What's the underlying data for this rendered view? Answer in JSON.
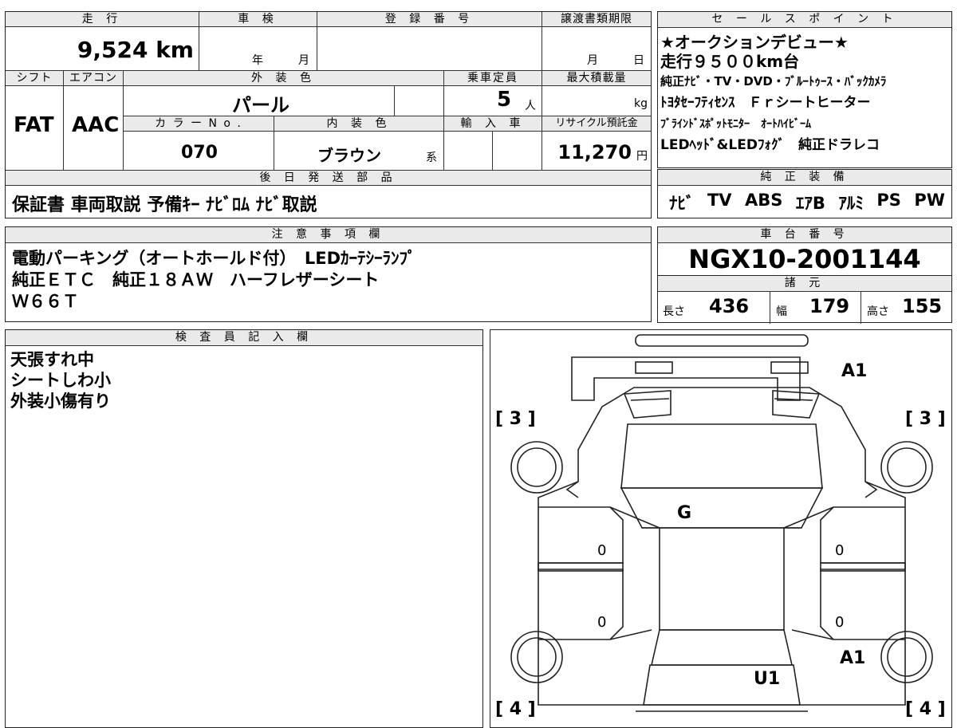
{
  "top_table": {
    "mileage_header": "走 行",
    "mileage_value": "9,524 km",
    "inspection_header": "車 検",
    "inspection_year": "年",
    "inspection_month": "月",
    "registration_header": "登 録 番 号",
    "transfer_header": "譲渡書類期限",
    "transfer_month": "月",
    "transfer_day": "日",
    "shift_header": "シフト",
    "ac_header": "エアコン",
    "ext_color_header": "外 装 色",
    "capacity_header": "乗車定員",
    "load_header": "最大積載量",
    "shift_value": "FAT",
    "ac_value": "AAC",
    "ext_color_value": "パール",
    "capacity_value": "5",
    "capacity_unit": "人",
    "load_unit": "kg",
    "color_no_header": "カ ラ ー N o .",
    "int_color_header": "内 装 色",
    "import_header": "輸 入 車",
    "recycle_header": "リサイクル預託金",
    "color_no_value": "070",
    "int_color_value": "ブラウン",
    "int_color_suffix": "系",
    "recycle_value": "11,270",
    "recycle_unit": "円",
    "later_parts_header": "後 日 発 送 部 品",
    "later_parts_value": "保証書 車両取説 予備ｷｰ ﾅﾋﾞﾛﾑ ﾅﾋﾞ取説"
  },
  "sales_points": {
    "header": "セ ー ル ス ポ イ ン ト",
    "lines": [
      "★オークションデビュー★",
      "走行９５００km台",
      "純正ﾅﾋﾞ・TV・DVD・ﾌﾞﾙｰﾄｩｰｽ・ﾊﾞｯｸｶﾒﾗ",
      "ﾄﾖﾀｾｰﾌﾃｨｾﾝｽ　Ｆｒシートヒーター",
      "ﾌﾞﾗｲﾝﾄﾞｽﾎﾟｯﾄﾓﾆﾀｰ　ｵｰﾄﾊｲﾋﾞｰﾑ",
      "LEDﾍｯﾄﾞ&LEDﾌｫｸﾞ　純正ドラレコ"
    ]
  },
  "equipment": {
    "header": "純 正 装 備",
    "items": [
      "ﾅﾋﾞ",
      "TV",
      "ABS",
      "ｴｱB",
      "ｱﾙﾐ",
      "PS",
      "PW"
    ]
  },
  "notes": {
    "header": "注 意 事 項 欄",
    "lines": [
      "電動パーキング（オートホールド付）　LEDｶｰﾃｼｰﾗﾝﾌﾟ",
      "純正ＥＴＣ　純正１８ＡＷ　ハーフレザーシート",
      "Ｗ６６Ｔ"
    ]
  },
  "chassis": {
    "header": "車 台 番 号",
    "value": "NGX10-2001144"
  },
  "specs": {
    "header": "諸 元",
    "length_label": "長さ",
    "length_value": "436",
    "width_label": "幅",
    "width_value": "179",
    "height_label": "高さ",
    "height_value": "155"
  },
  "inspector": {
    "header": "検 査 員 記 入 欄",
    "lines": [
      "天張すれ中",
      "シートしわ小",
      "外装小傷有り"
    ]
  },
  "diagram": {
    "marks": {
      "front_bumper": "A1",
      "hood": "G",
      "rear_right": "A1",
      "rear_center": "U1",
      "door_left_front": "0",
      "door_left_rear": "0",
      "door_right_front": "0",
      "door_right_rear": "0",
      "tire_front_left": "[ 3 ]",
      "tire_front_right": "[ 3 ]",
      "tire_rear_left": "[ 4 ]",
      "tire_rear_right": "[ 4 ]"
    }
  }
}
